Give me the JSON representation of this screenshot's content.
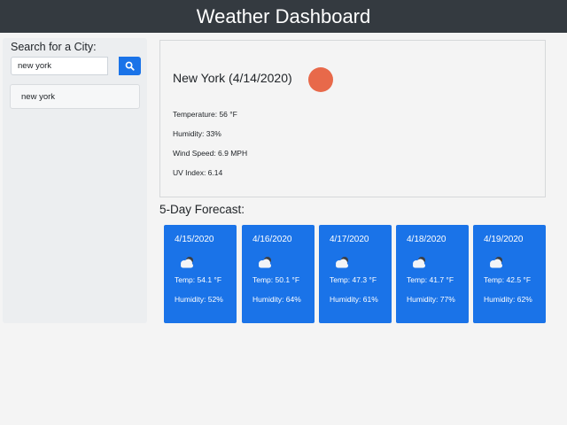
{
  "header": {
    "title": "Weather Dashboard"
  },
  "sidebar": {
    "search_label": "Search for a City:",
    "search_value": "new york",
    "search_icon": "search-icon",
    "history": [
      "new york"
    ]
  },
  "current": {
    "title": "New York (4/14/2020)",
    "temperature": "Temperature: 56 °F",
    "humidity": "Humidity: 33%",
    "wind": "Wind Speed: 6.9 MPH",
    "uv": "UV Index: 6.14",
    "icon": "sun-icon",
    "icon_color": "#e8694a"
  },
  "forecast": {
    "title": "5-Day Forecast:",
    "card_color": "#1a73e8",
    "days": [
      {
        "date": "4/15/2020",
        "icon": "partly-cloudy-icon",
        "temp": "Temp: 54.1 °F",
        "humidity": "Humidity: 52%"
      },
      {
        "date": "4/16/2020",
        "icon": "partly-cloudy-icon",
        "temp": "Temp: 50.1 °F",
        "humidity": "Humidity: 64%"
      },
      {
        "date": "4/17/2020",
        "icon": "partly-cloudy-icon",
        "temp": "Temp: 47.3 °F",
        "humidity": "Humidity: 61%"
      },
      {
        "date": "4/18/2020",
        "icon": "partly-cloudy-icon",
        "temp": "Temp: 41.7 °F",
        "humidity": "Humidity: 77%"
      },
      {
        "date": "4/19/2020",
        "icon": "partly-cloudy-icon",
        "temp": "Temp: 42.5 °F",
        "humidity": "Humidity: 62%"
      }
    ]
  }
}
